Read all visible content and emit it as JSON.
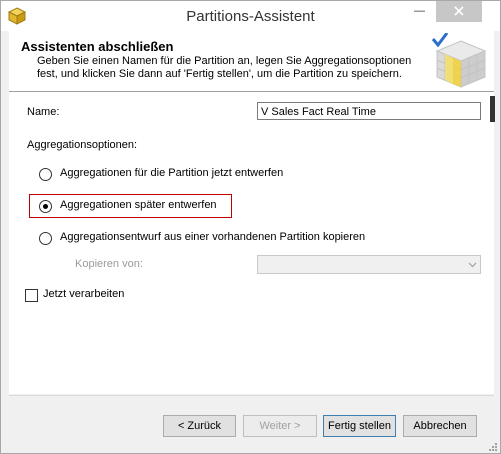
{
  "window": {
    "title": "Partitions-Assistent",
    "minimize_label": "—",
    "close_label": "×"
  },
  "header": {
    "title": "Assistenten abschließen",
    "description": "Geben Sie einen Namen für die Partition an, legen Sie Aggregationsoptionen fest, und klicken Sie dann auf 'Fertig stellen', um die Partition zu speichern."
  },
  "form": {
    "name_label": "Name:",
    "name_value": "V Sales Fact Real Time",
    "aggregation_options_label": "Aggregationsoptionen:",
    "options": [
      {
        "label": "Aggregationen für die Partition jetzt entwerfen",
        "checked": false
      },
      {
        "label": "Aggregationen später entwerfen",
        "checked": true
      },
      {
        "label": "Aggregationsentwurf aus einer vorhandenen Partition kopieren",
        "checked": false
      }
    ],
    "copy_from_label": "Kopieren von:",
    "copy_from_value": "",
    "process_now_label": "Jetzt verarbeiten",
    "process_now_checked": false
  },
  "buttons": {
    "back": "< Zurück",
    "next": "Weiter >",
    "finish": "Fertig stellen",
    "cancel": "Abbrechen"
  },
  "colors": {
    "highlight_border": "#c00000",
    "primary_button_border": "#3c7fb1",
    "disabled_text": "#a0a0a0"
  }
}
